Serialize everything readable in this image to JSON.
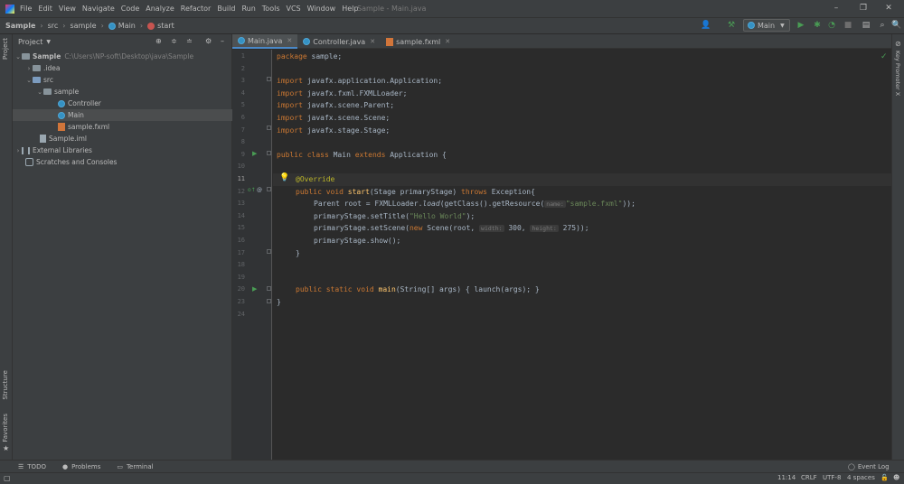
{
  "menubar": {
    "items": [
      "File",
      "Edit",
      "View",
      "Navigate",
      "Code",
      "Analyze",
      "Refactor",
      "Build",
      "Run",
      "Tools",
      "VCS",
      "Window",
      "Help"
    ],
    "title": "Sample - Main.java"
  },
  "navbar": {
    "crumbs": [
      "Sample",
      "src",
      "sample",
      "Main",
      "start"
    ],
    "run_config": "Main"
  },
  "project_panel": {
    "title": "Project",
    "tree": [
      {
        "label": "Sample",
        "path": "C:\\Users\\NP-soft\\Desktop\\java\\Sample"
      },
      {
        "label": ".idea"
      },
      {
        "label": "src"
      },
      {
        "label": "sample"
      },
      {
        "label": "Controller"
      },
      {
        "label": "Main"
      },
      {
        "label": "sample.fxml"
      },
      {
        "label": "Sample.iml"
      },
      {
        "label": "External Libraries"
      },
      {
        "label": "Scratches and Consoles"
      }
    ]
  },
  "left_strip": {
    "project": "Project",
    "structure": "Structure",
    "favorites": "Favorites"
  },
  "right_strip": {
    "key_promoter": "Key Promoter X"
  },
  "tabs": [
    {
      "label": "Main.java"
    },
    {
      "label": "Controller.java"
    },
    {
      "label": "sample.fxml"
    }
  ],
  "editor": {
    "line_numbers": [
      "1",
      "2",
      "3",
      "4",
      "5",
      "6",
      "7",
      "8",
      "9",
      "10",
      "11",
      "12",
      "13",
      "14",
      "15",
      "16",
      "17",
      "18",
      "19",
      "20",
      "23",
      "24"
    ],
    "caret_line": 11,
    "code": {
      "l1_kw": "package",
      "l1_rest": " sample;",
      "import_kw": "import",
      "imports": [
        " javafx.application.Application;",
        " javafx.fxml.FXMLLoader;",
        " javafx.scene.Parent;",
        " javafx.scene.Scene;",
        " javafx.stage.Stage;"
      ],
      "l9_a": "public class",
      "l9_b": " Main ",
      "l9_c": "extends",
      "l9_d": " Application {",
      "l11": "@Override",
      "l12_a": "public void ",
      "l12_b": "start",
      "l12_c": "(Stage primaryStage) ",
      "l12_d": "throws",
      "l12_e": " Exception{",
      "l13_a": "Parent root = FXMLLoader.",
      "l13_b": "load",
      "l13_c": "(getClass().getResource(",
      "l13_hint": "name:",
      "l13_str": "\"sample.fxml\"",
      "l13_d": "));",
      "l14_a": "primaryStage.setTitle(",
      "l14_str": "\"Hello World\"",
      "l14_b": ");",
      "l15_a": "primaryStage.setScene(",
      "l15_kw": "new",
      "l15_b": " Scene(root, ",
      "l15_h1": "width:",
      "l15_n1": " 300, ",
      "l15_h2": "height:",
      "l15_n2": " 275));",
      "l16": "primaryStage.show();",
      "l17": "}",
      "l20_a": "public static void ",
      "l20_b": "main",
      "l20_c": "(String[] args) { launch(args); }",
      "l23": "}"
    }
  },
  "bottom_tools": {
    "todo": "TODO",
    "problems": "Problems",
    "terminal": "Terminal",
    "event_log": "Event Log"
  },
  "status": {
    "position": "11:14",
    "line_sep": "CRLF",
    "encoding": "UTF-8",
    "indent": "4 spaces"
  }
}
